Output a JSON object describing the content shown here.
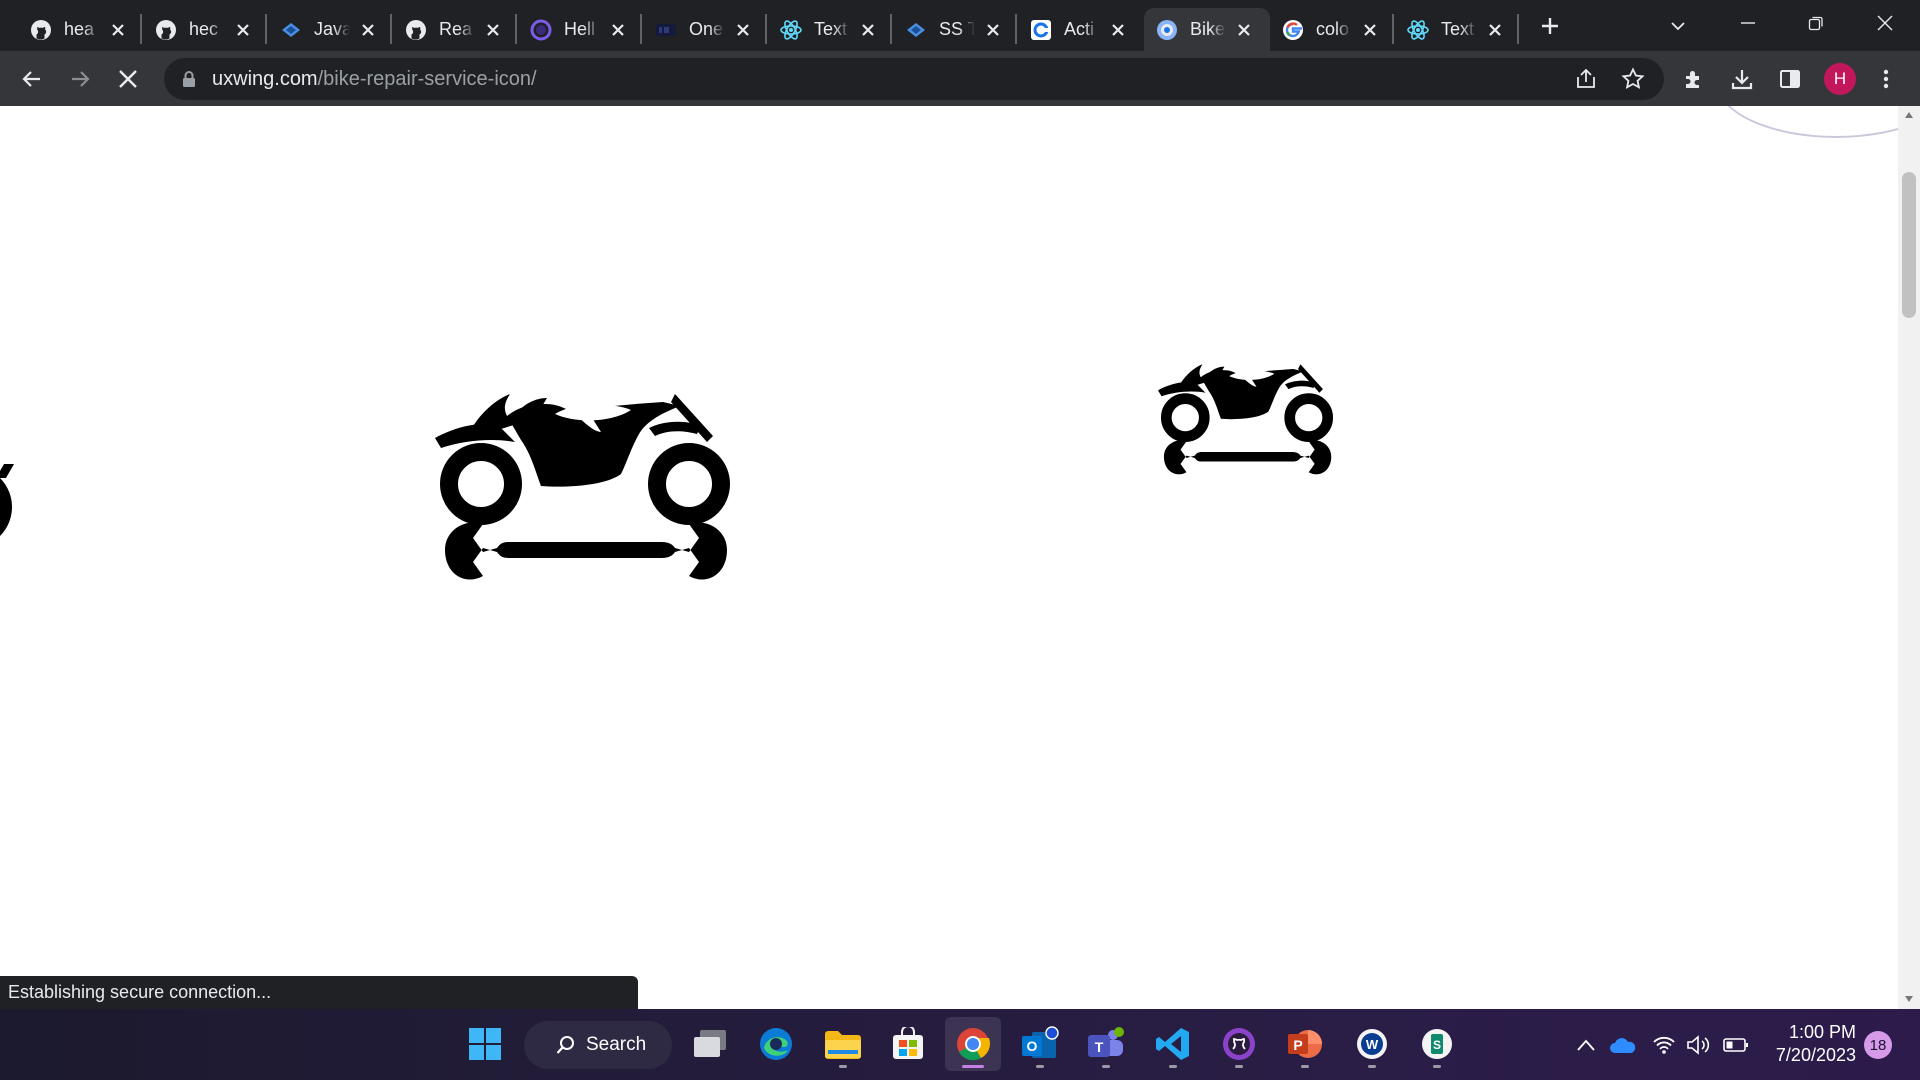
{
  "browser": {
    "tabs": [
      {
        "title": "hea",
        "icon": "github-icon"
      },
      {
        "title": "hec",
        "icon": "github-icon"
      },
      {
        "title": "Java",
        "icon": "jetbrains-icon"
      },
      {
        "title": "Rea",
        "icon": "github-icon"
      },
      {
        "title": "Hell",
        "icon": "circle-icon"
      },
      {
        "title": "One",
        "icon": "onecompiler-icon"
      },
      {
        "title": "Text",
        "icon": "react-icon"
      },
      {
        "title": "SS T",
        "icon": "jetbrains-icon"
      },
      {
        "title": "Acti",
        "icon": "site-icon"
      },
      {
        "title": "Bike",
        "icon": "uxwing-icon",
        "active": true
      },
      {
        "title": "colo",
        "icon": "google-icon"
      },
      {
        "title": "Text",
        "icon": "react-icon"
      }
    ],
    "address": {
      "domain": "uxwing.com",
      "path": "/bike-repair-service-icon/"
    },
    "profile_initial": "H",
    "status_message": "Establishing secure connection..."
  },
  "taskbar": {
    "search_label": "Search",
    "time": "1:00 PM",
    "date": "7/20/2023",
    "notification_count": "18"
  },
  "colors": {
    "tabstrip": "#202124",
    "toolbar": "#35363a",
    "profile": "#c2185b",
    "icon_fill": "#000000",
    "taskbar_accent": "#c67fe7"
  }
}
